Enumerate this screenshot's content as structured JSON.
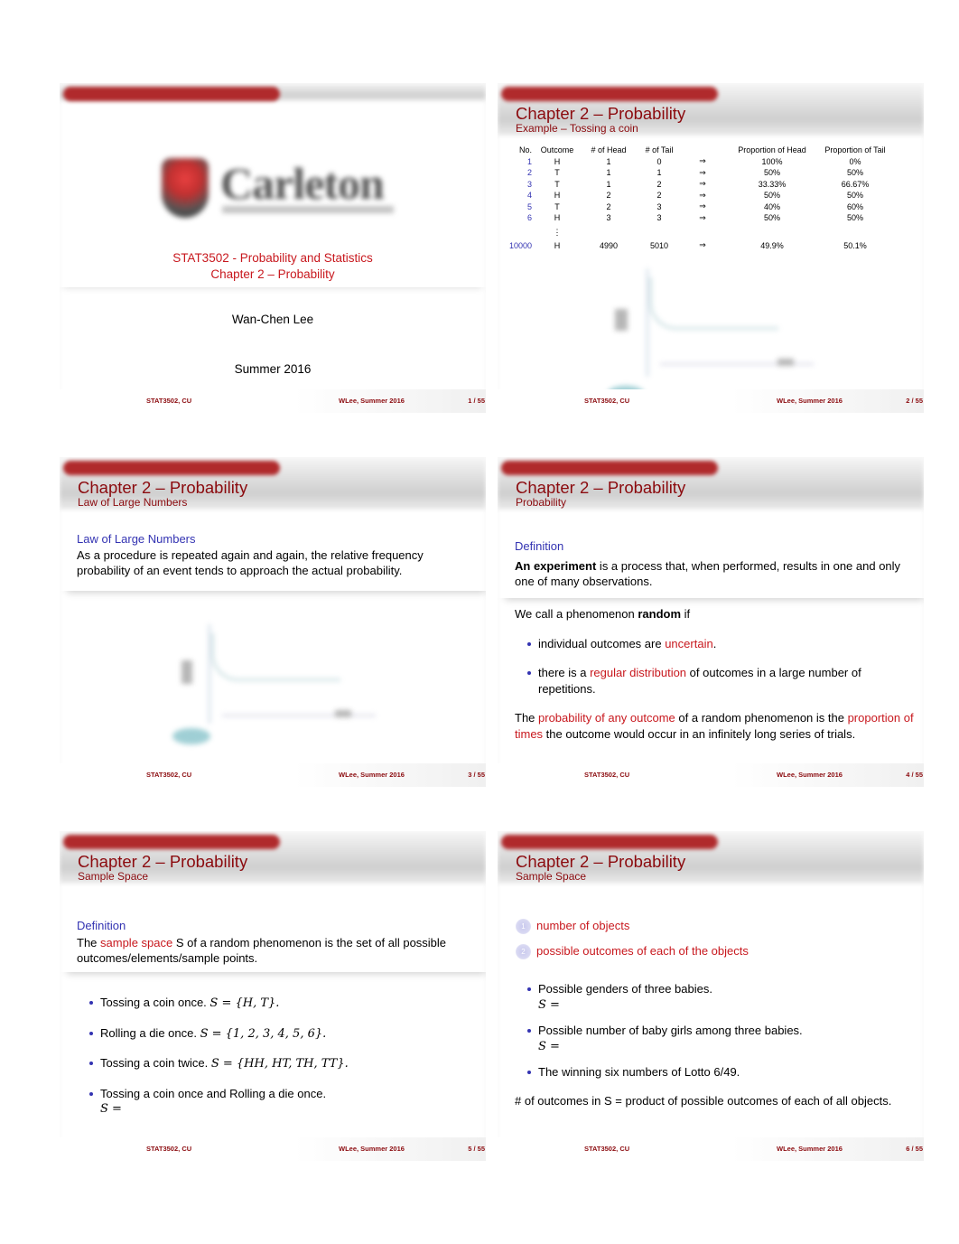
{
  "colors": {
    "title": "#8b0a0e",
    "accent_red": "#c8181e",
    "block_blue": "#3333b2",
    "headbar_red": "#b02a2c"
  },
  "footer": {
    "left": "STAT3502, CU",
    "mid": "WLee, Summer 2016"
  },
  "slides": [
    {
      "page": "1 / 55",
      "logo": {
        "icon": "carleton-shield-icon",
        "wordmark": "Carleton"
      },
      "course": "STAT3502 - Probability and Statistics",
      "chapter": "Chapter 2 – Probability",
      "author": "Wan-Chen Lee",
      "date": "Summer 2016"
    },
    {
      "page": "2 / 55",
      "title": "Chapter 2 – Probability",
      "subtitle": "Example – Tossing a coin",
      "table": {
        "headers": [
          "No.",
          "Outcome",
          "# of Head",
          "# of Tail",
          "",
          "Proportion of Head",
          "Proportion of Tail"
        ],
        "rows": [
          [
            "1",
            "H",
            "1",
            "0",
            "⇒",
            "100%",
            "0%"
          ],
          [
            "2",
            "T",
            "1",
            "1",
            "⇒",
            "50%",
            "50%"
          ],
          [
            "3",
            "T",
            "1",
            "2",
            "⇒",
            "33.33%",
            "66.67%"
          ],
          [
            "4",
            "H",
            "2",
            "2",
            "⇒",
            "50%",
            "50%"
          ],
          [
            "5",
            "T",
            "2",
            "3",
            "⇒",
            "40%",
            "60%"
          ],
          [
            "6",
            "H",
            "3",
            "3",
            "⇒",
            "50%",
            "50%"
          ]
        ],
        "ellipsis": "⋮",
        "last_row": [
          "10000",
          "H",
          "4990",
          "5010",
          "⇒",
          "49.9%",
          "50.1%"
        ]
      }
    },
    {
      "page": "3 / 55",
      "title": "Chapter 2 – Probability",
      "subtitle": "Law of Large Numbers",
      "block_title": "Law of Large Numbers",
      "block_text": "As a procedure is repeated again and again, the relative frequency probability of an event tends to approach the actual probability."
    },
    {
      "page": "4 / 55",
      "title": "Chapter 2 – Probability",
      "subtitle": "Probability",
      "block_title": "Definition",
      "def_bold": "An experiment",
      "def_rest": " is a process that, when performed, results in one and only one of many observations.",
      "random_pre": "We call a phenomenon ",
      "random_bold": "random",
      "random_post": " if",
      "bullets": [
        {
          "pre": "individual outcomes are ",
          "red": "uncertain",
          "post": "."
        },
        {
          "pre": "there is a ",
          "red": "regular distribution",
          "post": " of outcomes in a large number of repetitions."
        }
      ],
      "closing": {
        "p1": "The ",
        "r1": "probability of any outcome",
        "p2": " of a random phenomenon is the ",
        "r2": "proportion of times",
        "p3": " the outcome would occur in an infinitely long series of trials."
      }
    },
    {
      "page": "5 / 55",
      "title": "Chapter 2 – Probability",
      "subtitle": "Sample Space",
      "block_title": "Definition",
      "def_pre": "The ",
      "def_red": "sample space",
      "def_post": " S of a random phenomenon is the set of all possible outcomes/elements/sample points.",
      "bullets": [
        {
          "text": "Tossing a coin once. ",
          "math": "S = {H, T}."
        },
        {
          "text": "Rolling a die once. ",
          "math": "S = {1, 2, 3, 4, 5, 6}."
        },
        {
          "text": "Tossing a coin twice. ",
          "math": "S = {HH, HT, TH, TT}."
        },
        {
          "text": "Tossing a coin once and Rolling a die once.",
          "math": "S ="
        }
      ]
    },
    {
      "page": "6 / 55",
      "title": "Chapter 2 – Probability",
      "subtitle": "Sample Space",
      "enum": [
        {
          "num": "1",
          "text": "number of objects"
        },
        {
          "num": "2",
          "text": "possible outcomes of each of the objects"
        }
      ],
      "bullets": [
        {
          "text": "Possible genders of three babies.",
          "math": "S ="
        },
        {
          "text": "Possible number of baby girls among three babies.",
          "math": "S ="
        },
        {
          "text": "The winning six numbers of Lotto 6/49.",
          "math": ""
        }
      ],
      "closing": "# of outcomes in S = product of possible outcomes of each of all objects."
    }
  ]
}
